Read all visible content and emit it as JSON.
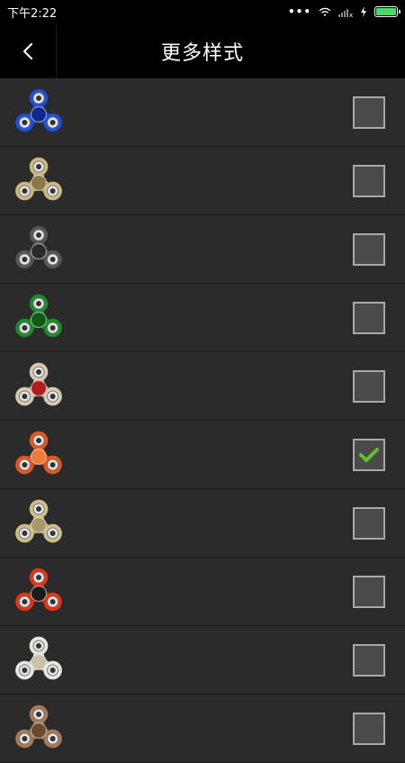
{
  "status_bar": {
    "time": "下午2:22",
    "icons": [
      "more-dots-icon",
      "wifi-icon",
      "signal-icon",
      "charging-icon",
      "battery-icon"
    ],
    "battery_level": 1.0,
    "battery_color": "#4cd964"
  },
  "header": {
    "back_icon": "chevron-left-icon",
    "title": "更多样式"
  },
  "styles": [
    {
      "name": "blue",
      "body": "#1f4fd8",
      "cap": "#0b2a8c",
      "checked": false
    },
    {
      "name": "brass-tri",
      "body": "#c9b983",
      "cap": "#8a7a45",
      "checked": false
    },
    {
      "name": "dark-metal",
      "body": "#555555",
      "cap": "#2a2a2a",
      "checked": false
    },
    {
      "name": "green",
      "body": "#1f8a2a",
      "cap": "#0d5a16",
      "checked": false
    },
    {
      "name": "beige-red",
      "body": "#d8c9b0",
      "cap": "#b01b1b",
      "checked": false
    },
    {
      "name": "orange-led",
      "body": "#e0581e",
      "cap": "#f07a3a",
      "checked": true
    },
    {
      "name": "gold",
      "body": "#cdbf8a",
      "cap": "#a8986a",
      "checked": false
    },
    {
      "name": "red-black",
      "body": "#e0331a",
      "cap": "#1a1a1a",
      "checked": false
    },
    {
      "name": "white-led",
      "body": "#e8e6e0",
      "cap": "#c9c2a8",
      "checked": false
    },
    {
      "name": "wood",
      "body": "#a57a55",
      "cap": "#6b4a30",
      "checked": false
    }
  ],
  "check_color": "#5fc22a"
}
